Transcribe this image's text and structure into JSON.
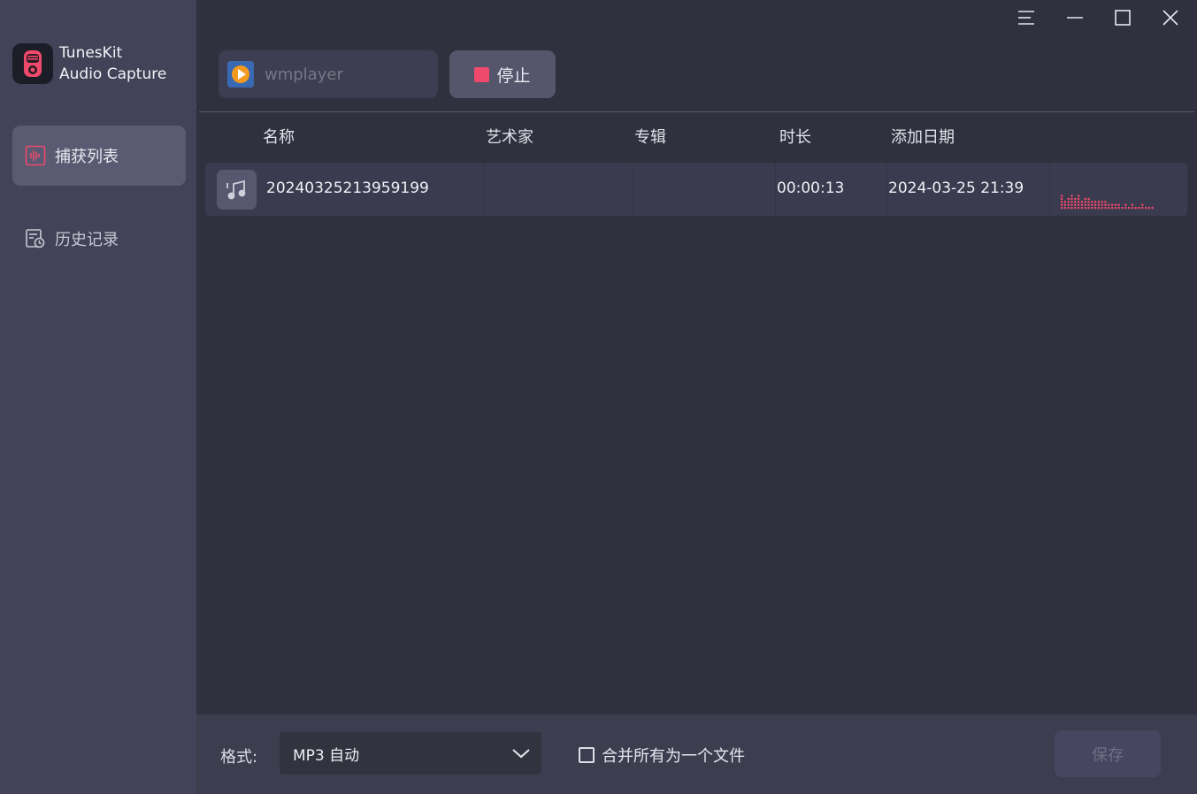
{
  "app": {
    "title_line1": "TunesKit",
    "title_line2": "Audio Capture"
  },
  "sidebar": {
    "items": [
      {
        "label": "捕获列表",
        "icon": "waveform-icon",
        "active": true
      },
      {
        "label": "历史记录",
        "icon": "history-icon",
        "active": false
      }
    ]
  },
  "window_controls": [
    "menu-icon",
    "minimize-icon",
    "maximize-icon",
    "close-icon"
  ],
  "toolbar": {
    "source_name": "wmplayer",
    "stop_label": "停止"
  },
  "table": {
    "columns": [
      "名称",
      "艺术家",
      "专辑",
      "时长",
      "添加日期"
    ],
    "rows": [
      {
        "name": "20240325213959199",
        "artist": "",
        "album": "",
        "duration": "00:00:13",
        "date_added": "2024-03-25 21:39"
      }
    ]
  },
  "footer": {
    "format_label": "格式:",
    "format_value": "MP3 自动",
    "merge_label": "合并所有为一个文件",
    "merge_checked": false,
    "save_label": "保存"
  },
  "colors": {
    "accent": "#ef4a6b",
    "sidebar_bg": "#424258",
    "main_bg": "#30303e"
  }
}
